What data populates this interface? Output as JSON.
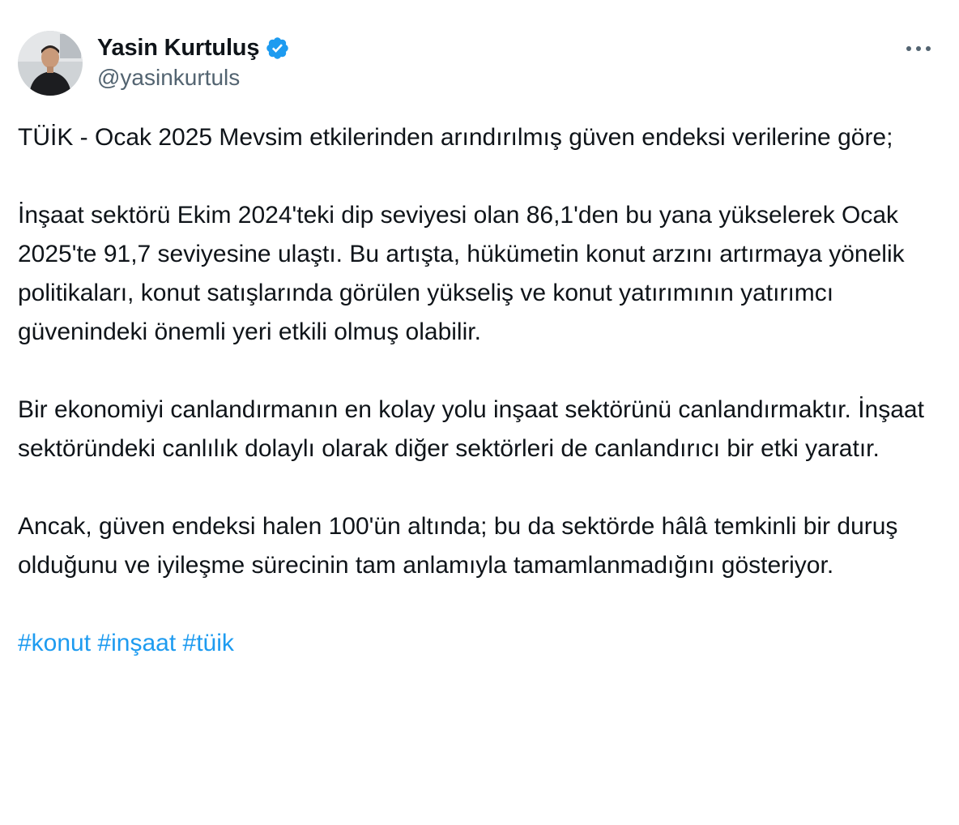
{
  "author": {
    "display_name": "Yasin Kurtuluş",
    "handle": "@yasinkurtuls",
    "avatar_icon": "avatar-photo",
    "verified_icon": "verified-badge-icon"
  },
  "menu": {
    "icon": "more-options-icon"
  },
  "tweet": {
    "paragraphs": [
      "TÜİK - Ocak 2025 Mevsim etkilerinden arındırılmış güven endeksi verilerine göre;",
      "İnşaat sektörü Ekim 2024'teki dip seviyesi olan 86,1'den bu yana yükselerek Ocak 2025'te 91,7 seviyesine ulaştı. Bu artışta, hükümetin konut arzını artırmaya yönelik politikaları, konut satışlarında görülen yükseliş ve konut yatırımının yatırımcı güvenindeki önemli yeri etkili olmuş olabilir.",
      "Bir ekonomiyi canlandırmanın en kolay yolu inşaat sektörünü canlandırmaktır. İnşaat sektöründeki canlılık dolaylı olarak diğer sektörleri de canlandırıcı bir etki yaratır.",
      "Ancak, güven endeksi halen 100'ün altında; bu da sektörde hâlâ temkinli bir duruş olduğunu ve iyileşme sürecinin tam anlamıyla tamamlanmadığını gösteriyor."
    ],
    "hashtags": [
      "#konut",
      "#inşaat",
      "#tüik"
    ]
  },
  "colors": {
    "text": "#0f1419",
    "secondary": "#536471",
    "accent": "#1d9bf0",
    "background": "#ffffff"
  }
}
